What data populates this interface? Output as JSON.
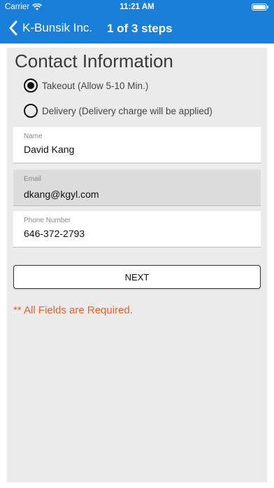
{
  "status_bar": {
    "carrier": "Carrier",
    "time": "11:21 AM",
    "battery_level": 1.0
  },
  "nav": {
    "back_label": "K-Bunsik Inc.",
    "steps": "1 of 3 steps"
  },
  "form": {
    "title": "Contact Information",
    "options": [
      {
        "label": "Takeout (Allow 5-10 Min.)",
        "selected": true
      },
      {
        "label": "Delivery (Delivery charge will be applied)",
        "selected": false
      }
    ],
    "fields": [
      {
        "label": "Name",
        "value": "David Kang",
        "background": "#ffffff"
      },
      {
        "label": "Email",
        "value": "dkang@kgyl.com",
        "background": "#dcdcdc"
      },
      {
        "label": "Phone Number",
        "value": "646-372-2793",
        "background": "#ffffff"
      }
    ],
    "next_label": "NEXT",
    "required_note": "** All Fields are Required."
  },
  "colors": {
    "accent": "#1a7fd9",
    "warning": "#e8632f",
    "panel": "#ebebeb"
  },
  "icons": {
    "back": "chevron-left-icon",
    "wifi": "wifi-icon",
    "battery": "battery-icon"
  }
}
